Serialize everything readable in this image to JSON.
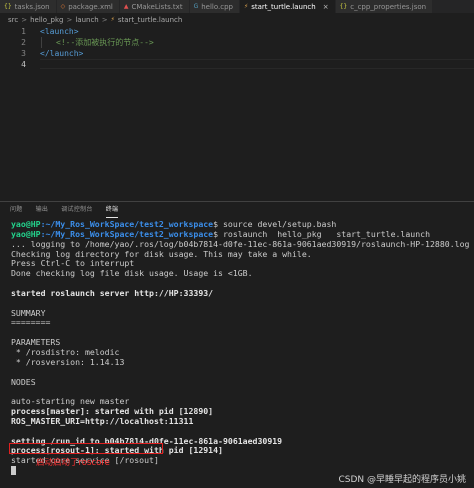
{
  "tabs": [
    {
      "label": "tasks.json",
      "icon": "json-file-icon",
      "icon_glyph": "{}",
      "icon_color": "#cbcb41",
      "active": false
    },
    {
      "label": "package.xml",
      "icon": "xml-file-icon",
      "icon_glyph": "◇",
      "icon_color": "#e37933",
      "active": false
    },
    {
      "label": "CMakeLists.txt",
      "icon": "cmake-file-icon",
      "icon_glyph": "▲",
      "icon_color": "#e05050",
      "active": false
    },
    {
      "label": "hello.cpp",
      "icon": "cpp-file-icon",
      "icon_glyph": "G",
      "icon_color": "#519aba",
      "active": false
    },
    {
      "label": "start_turtle.launch",
      "icon": "launch-file-icon",
      "icon_glyph": "⚡",
      "icon_color": "#e8ab53",
      "active": true
    },
    {
      "label": "c_cpp_properties.json",
      "icon": "json-file-icon",
      "icon_glyph": "{}",
      "icon_color": "#cbcb41",
      "active": false
    }
  ],
  "breadcrumb": [
    "src",
    "hello_pkg",
    "launch",
    "start_turtle.launch"
  ],
  "breadcrumb_sep": ">",
  "editor": {
    "lines": [
      {
        "num": "1",
        "tag": "<launch>",
        "comment": ""
      },
      {
        "num": "2",
        "tag": "",
        "comment": "<!--添加被执行的节点-->"
      },
      {
        "num": "3",
        "tag": "</launch>",
        "comment": ""
      },
      {
        "num": "4",
        "tag": "",
        "comment": ""
      }
    ]
  },
  "panel": {
    "tabs": [
      "问题",
      "输出",
      "调试控制台",
      "终端"
    ],
    "active_tab": "终端"
  },
  "terminal": {
    "prompt1": {
      "user": "yao@HP",
      "path": ":~/My_Ros_WorkSpace/test2_workspace",
      "cmd": "$ source devel/setup.bash"
    },
    "prompt2": {
      "user": "yao@HP",
      "path": ":~/My_Ros_WorkSpace/test2_workspace",
      "cmd": "$ roslaunch  hello_pkg   start_turtle.launch"
    },
    "lines": [
      {
        "text": "... logging to /home/yao/.ros/log/b04b7814-d0fe-11ec-861a-9061aed30919/roslaunch-HP-12880.log",
        "bold": false
      },
      {
        "text": "Checking log directory for disk usage. This may take a while.",
        "bold": false
      },
      {
        "text": "Press Ctrl-C to interrupt",
        "bold": false
      },
      {
        "text": "Done checking log file disk usage. Usage is <1GB.",
        "bold": false
      },
      {
        "text": "",
        "bold": false
      },
      {
        "text": "started roslaunch server http://HP:33393/",
        "bold": true
      },
      {
        "text": "",
        "bold": false
      },
      {
        "text": "SUMMARY",
        "bold": false
      },
      {
        "text": "========",
        "bold": false
      },
      {
        "text": "",
        "bold": false
      },
      {
        "text": "PARAMETERS",
        "bold": false
      },
      {
        "text": " * /rosdistro: melodic",
        "bold": false
      },
      {
        "text": " * /rosversion: 1.14.13",
        "bold": false
      },
      {
        "text": "",
        "bold": false
      },
      {
        "text": "NODES",
        "bold": false
      },
      {
        "text": "",
        "bold": false
      },
      {
        "text": "auto-starting new master",
        "bold": false
      },
      {
        "text": "process[master]: started with pid [12890]",
        "bold": true
      },
      {
        "text": "ROS_MASTER_URI=http://localhost:11311",
        "bold": true
      },
      {
        "text": "",
        "bold": false
      },
      {
        "text": "setting /run_id to b04b7814-d0fe-11ec-861a-9061aed30919",
        "bold": true
      },
      {
        "text": "process[rosout-1]: started with pid [12914]",
        "bold": true
      },
      {
        "text": "started core service [/rosout]",
        "bold": false
      }
    ]
  },
  "annotation": "启动启动了roscore",
  "watermark": "CSDN @早睡早起的程序员小姚",
  "colors": {
    "background": "#1e1e1e",
    "tag": "#569cd6",
    "comment": "#6a9955",
    "prompt_user": "#23d18b",
    "prompt_path": "#3b8eea",
    "annotation": "#ff3030"
  }
}
